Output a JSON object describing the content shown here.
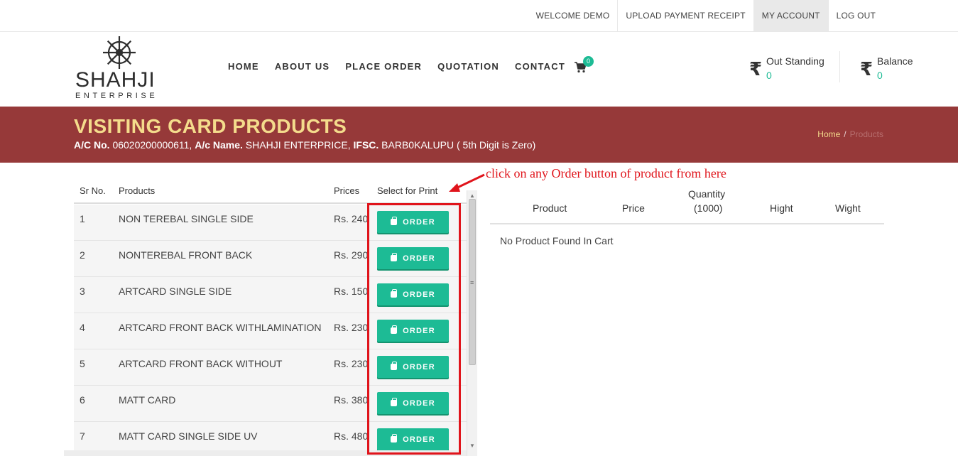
{
  "top_links": [
    {
      "label": "WELCOME DEMO"
    },
    {
      "label": "UPLOAD PAYMENT RECEIPT"
    },
    {
      "label": "MY ACCOUNT"
    },
    {
      "label": "LOG OUT"
    }
  ],
  "logo": {
    "name": "SHAHJI",
    "sub": "ENTERPRISE"
  },
  "nav": [
    {
      "label": "HOME"
    },
    {
      "label": "ABOUT US"
    },
    {
      "label": "PLACE ORDER"
    },
    {
      "label": "QUOTATION"
    },
    {
      "label": "CONTACT"
    }
  ],
  "cart": {
    "count": "0",
    "icon": "cart-icon"
  },
  "stats": {
    "outstanding": {
      "label": "Out Standing",
      "value": "0",
      "symbol": "₹"
    },
    "balance": {
      "label": "Balance",
      "value": "0",
      "symbol": "₹"
    }
  },
  "banner": {
    "title": "VISITING CARD PRODUCTS",
    "acc_no_label": "A/C No.",
    "acc_no": "06020200000611,",
    "acc_name_label": "A/c Name.",
    "acc_name": "SHAHJI ENTERPRICE,",
    "ifsc_label": "IFSC.",
    "ifsc": "BARB0KALUPU ( 5th Digit is Zero)",
    "breadcrumb_home": "Home",
    "breadcrumb_sep": "/",
    "breadcrumb_current": "Products"
  },
  "product_table": {
    "headers": {
      "sr": "Sr No.",
      "product": "Products",
      "price": "Prices",
      "select": "Select for Print"
    },
    "order_label": "ORDER",
    "rows": [
      {
        "sr": "1",
        "name": "NON TEREBAL SINGLE SIDE",
        "price": "Rs. 240"
      },
      {
        "sr": "2",
        "name": "NONTEREBAL FRONT BACK",
        "price": "Rs. 290"
      },
      {
        "sr": "3",
        "name": "ARTCARD SINGLE SIDE",
        "price": "Rs. 150"
      },
      {
        "sr": "4",
        "name": "ARTCARD FRONT BACK WITHLAMINATION",
        "price": "Rs. 230"
      },
      {
        "sr": "5",
        "name": "ARTCARD FRONT BACK WITHOUT",
        "price": "Rs. 230"
      },
      {
        "sr": "6",
        "name": "MATT CARD",
        "price": "Rs. 380"
      },
      {
        "sr": "7",
        "name": "MATT CARD SINGLE SIDE UV",
        "price": "Rs. 480"
      }
    ]
  },
  "annotation": "click on any Order button of product from here",
  "cart_table": {
    "headers": {
      "product": "Product",
      "price": "Price",
      "quantity": "Quantity",
      "quantity_unit": "(1000)",
      "height": "Hight",
      "width": "Wight"
    },
    "empty_message": "No Product Found In Cart"
  },
  "colors": {
    "accent": "#1dbb95",
    "banner": "#963939",
    "banner_title": "#f4dc8c",
    "annotation": "#e0141b"
  }
}
